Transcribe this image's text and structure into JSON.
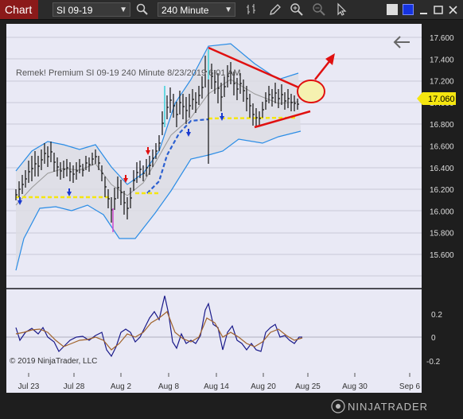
{
  "toolbar": {
    "tab_label": "Chart",
    "instrument": "SI 09-19",
    "interval": "240 Minute"
  },
  "chart": {
    "title_line": "Remek!  Premium  SI 09-19  240 Minute  8/23/2019 6:01 AM",
    "copyright": "© 2019 NinjaTrader, LLC",
    "last_price": "17.060",
    "price_ticks": [
      "17.600",
      "17.400",
      "17.200",
      "17.000",
      "16.800",
      "16.600",
      "16.400",
      "16.200",
      "16.000",
      "15.800",
      "15.600"
    ],
    "osc_ticks": [
      "0.2",
      "0",
      "-0.2"
    ],
    "date_ticks": [
      "Jul 23",
      "Jul 28",
      "Aug 2",
      "Aug 8",
      "Aug 14",
      "Aug 20",
      "Aug 25",
      "Aug 30",
      "Sep 6"
    ],
    "colors": {
      "background": "#e9e9f5",
      "band": "#2b8de6",
      "trendline": "#e01010",
      "support": "#f5e610",
      "price_label_bg": "#f5e610"
    }
  },
  "footer": {
    "brand": "NINJATRADER"
  }
}
